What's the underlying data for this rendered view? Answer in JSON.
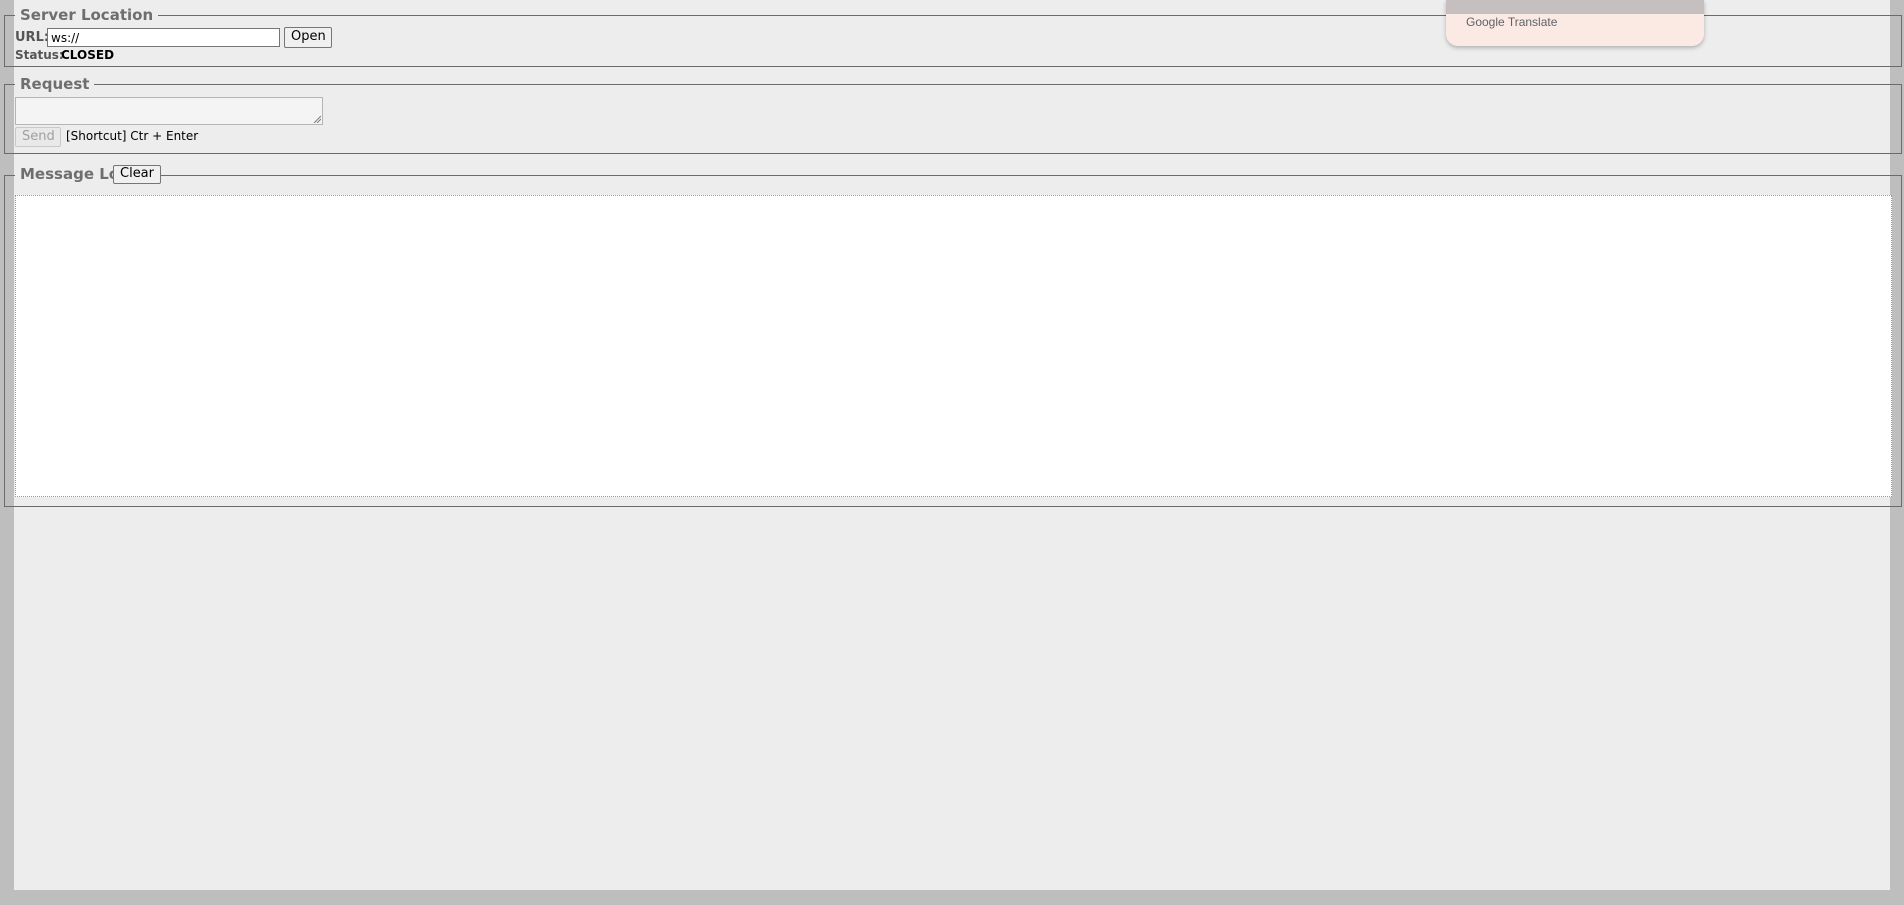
{
  "server_location": {
    "legend": "Server Location",
    "url_label": "URL:",
    "url_value": "ws://",
    "open_button": "Open",
    "status_label": "Status:",
    "status_value": "CLOSED"
  },
  "request": {
    "legend": "Request",
    "textarea_value": "",
    "send_button": "Send",
    "shortcut_hint": "[Shortcut] Ctr + Enter"
  },
  "message_log": {
    "legend": "Message Log",
    "clear_button": "Clear",
    "entries": []
  },
  "translate_popup": {
    "brand": "Google",
    "product": "Translate"
  },
  "colors": {
    "page_background": "#ededed",
    "outer_background": "#bebebe",
    "legend_text": "#6e6e6e",
    "log_background": "#ffffff",
    "popup_background": "#fbe9e3"
  }
}
